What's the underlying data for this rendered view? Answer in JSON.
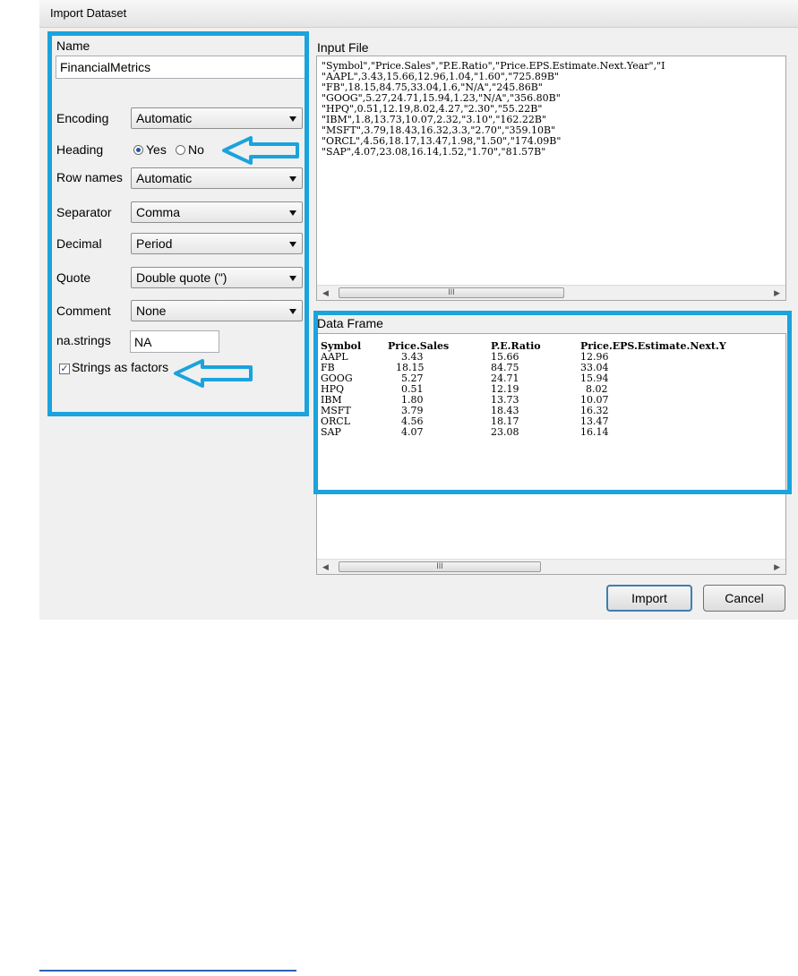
{
  "dialog": {
    "title": "Import Dataset"
  },
  "left": {
    "name_label": "Name",
    "name_value": "FinancialMetrics",
    "encoding_label": "Encoding",
    "encoding_value": "Automatic",
    "heading_label": "Heading",
    "heading_yes": "Yes",
    "heading_no": "No",
    "heading_selected": "Yes",
    "rownames_label": "Row names",
    "rownames_value": "Automatic",
    "separator_label": "Separator",
    "separator_value": "Comma",
    "decimal_label": "Decimal",
    "decimal_value": "Period",
    "quote_label": "Quote",
    "quote_value": "Double quote (\")",
    "comment_label": "Comment",
    "comment_value": "None",
    "nastrings_label": "na.strings",
    "nastrings_value": "NA",
    "strings_factors_label": "Strings as factors",
    "strings_factors_checked": true
  },
  "input_file": {
    "label": "Input File",
    "lines": [
      "\"Symbol\",\"Price.Sales\",\"P.E.Ratio\",\"Price.EPS.Estimate.Next.Year\",\"I",
      "\"AAPL\",3.43,15.66,12.96,1.04,\"1.60\",\"725.89B\"",
      "\"FB\",18.15,84.75,33.04,1.6,\"N/A\",\"245.86B\"",
      "\"GOOG\",5.27,24.71,15.94,1.23,\"N/A\",\"356.80B\"",
      "\"HPQ\",0.51,12.19,8.02,4.27,\"2.30\",\"55.22B\"",
      "\"IBM\",1.8,13.73,10.07,2.32,\"3.10\",\"162.22B\"",
      "\"MSFT\",3.79,18.43,16.32,3.3,\"2.70\",\"359.10B\"",
      "\"ORCL\",4.56,18.17,13.47,1.98,\"1.50\",\"174.09B\"",
      "\"SAP\",4.07,23.08,16.14,1.52,\"1.70\",\"81.57B\""
    ]
  },
  "data_frame": {
    "label": "Data Frame",
    "columns": [
      "Symbol",
      "Price.Sales",
      "P.E.Ratio",
      "Price.EPS.Estimate.Next.Y"
    ],
    "rows": [
      [
        "AAPL",
        "3.43",
        "15.66",
        "12.96"
      ],
      [
        "FB",
        "18.15",
        "84.75",
        "33.04"
      ],
      [
        "GOOG",
        "5.27",
        "24.71",
        "15.94"
      ],
      [
        "HPQ",
        "0.51",
        "12.19",
        "8.02"
      ],
      [
        "IBM",
        "1.80",
        "13.73",
        "10.07"
      ],
      [
        "MSFT",
        "3.79",
        "18.43",
        "16.32"
      ],
      [
        "ORCL",
        "4.56",
        "18.17",
        "13.47"
      ],
      [
        "SAP",
        "4.07",
        "23.08",
        "16.14"
      ]
    ]
  },
  "scrollbar_grip": "III",
  "buttons": {
    "import": "Import",
    "cancel": "Cancel"
  },
  "colors": {
    "annotation_blue": "#1aa3dd",
    "dialog_bg": "#f0f0f0"
  }
}
